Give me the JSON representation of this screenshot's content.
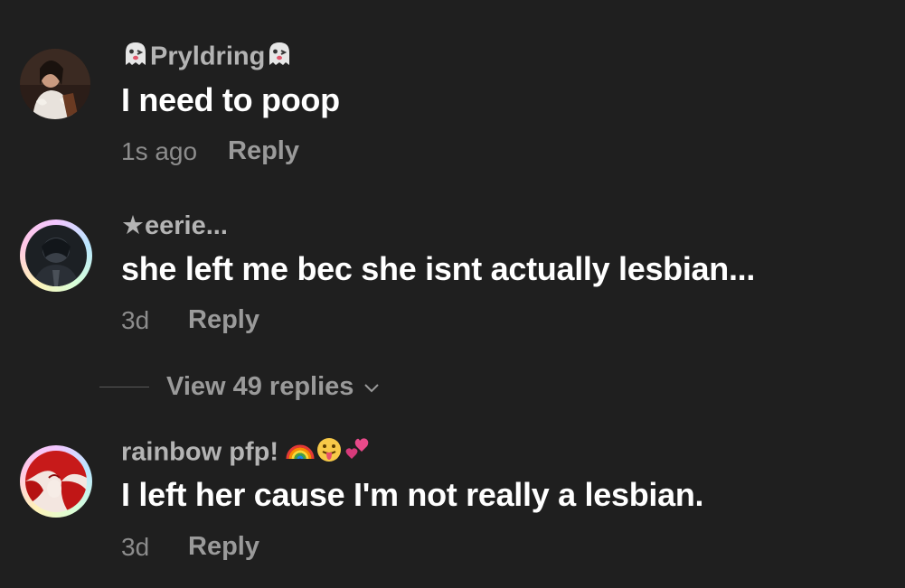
{
  "comments": [
    {
      "username_prefix_icon": "ghost-emoji",
      "username": "Pryldring",
      "username_suffix_icon": "ghost-emoji",
      "text": "I need to poop",
      "time": "1s ago",
      "reply_label": "Reply"
    },
    {
      "username_prefix_icon": "star-symbol",
      "username": "★eerie...",
      "text": "she left me bec she isnt actually lesbian...",
      "time": "3d",
      "reply_label": "Reply",
      "view_replies_label": "View 49 replies"
    },
    {
      "username": "rainbow pfp!",
      "username_suffix_icons": [
        "rainbow-emoji",
        "tongue-face-emoji",
        "two-hearts-emoji"
      ],
      "text": "I left her cause I'm not really a lesbian.",
      "time": "3d",
      "reply_label": "Reply"
    }
  ],
  "colors": {
    "background": "#1f1f1f",
    "username": "#b4b4b4",
    "comment_text": "#ffffff",
    "meta": "#8c8c8c",
    "reply": "#9a9a9a"
  }
}
